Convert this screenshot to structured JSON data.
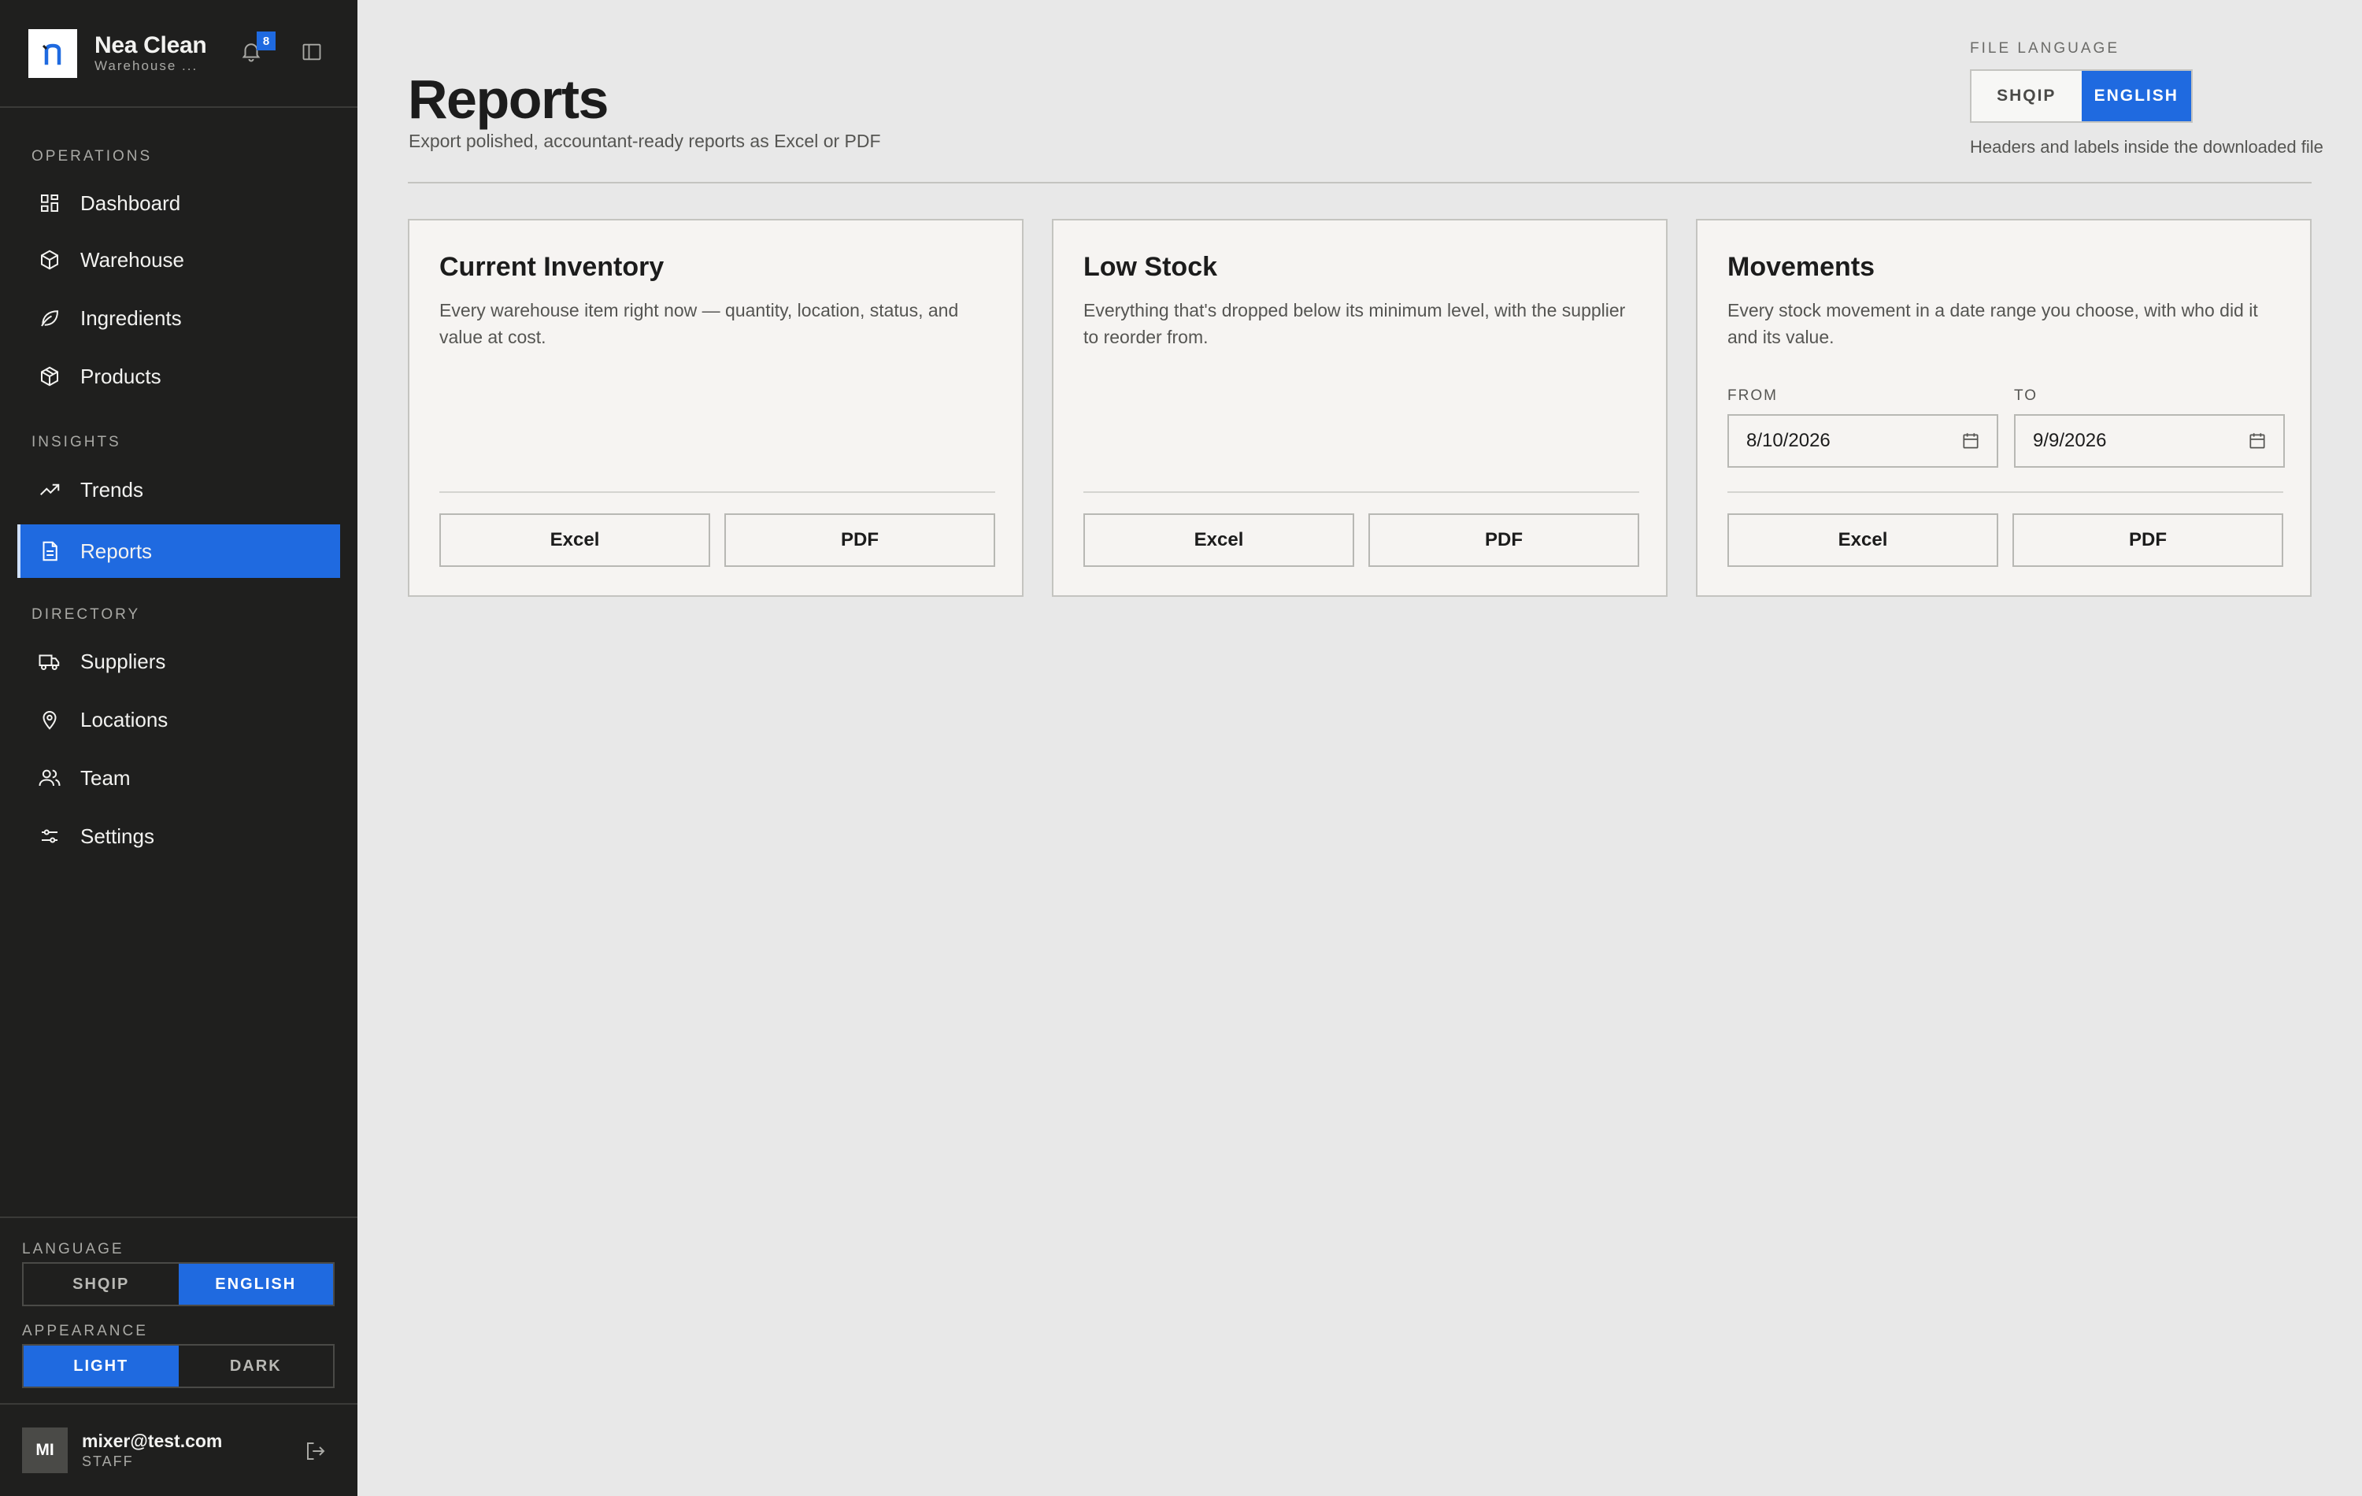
{
  "brand": {
    "name": "Nea Clean",
    "subtitle": "Warehouse ..."
  },
  "notifications": {
    "count": "8"
  },
  "nav": {
    "sections": {
      "operations": "OPERATIONS",
      "insights": "INSIGHTS",
      "directory": "DIRECTORY"
    },
    "items": [
      {
        "label": "Dashboard",
        "icon": "grid-icon"
      },
      {
        "label": "Warehouse",
        "icon": "box-icon"
      },
      {
        "label": "Ingredients",
        "icon": "leaf-icon"
      },
      {
        "label": "Products",
        "icon": "package-icon"
      },
      {
        "label": "Trends",
        "icon": "trend-icon"
      },
      {
        "label": "Reports",
        "icon": "report-icon",
        "active": true
      },
      {
        "label": "Suppliers",
        "icon": "truck-icon"
      },
      {
        "label": "Locations",
        "icon": "map-pin-icon"
      },
      {
        "label": "Team",
        "icon": "users-icon"
      },
      {
        "label": "Settings",
        "icon": "sliders-icon"
      }
    ]
  },
  "sidebar_settings": {
    "language_label": "LANGUAGE",
    "language_options": [
      "SHQIP",
      "ENGLISH"
    ],
    "language_selected": "ENGLISH",
    "appearance_label": "APPEARANCE",
    "appearance_options": [
      "LIGHT",
      "DARK"
    ],
    "appearance_selected": "LIGHT"
  },
  "user": {
    "initials": "MI",
    "email": "mixer@test.com",
    "role": "STAFF"
  },
  "page": {
    "title": "Reports",
    "subtitle": "Export polished, accountant-ready reports as Excel or PDF"
  },
  "file_language": {
    "label": "FILE LANGUAGE",
    "options": [
      "SHQIP",
      "ENGLISH"
    ],
    "selected": "ENGLISH",
    "hint": "Headers and labels inside the downloaded file"
  },
  "cards": [
    {
      "title": "Current Inventory",
      "description": "Every warehouse item right now — quantity, location, status, and value at cost.",
      "excel_label": "Excel",
      "pdf_label": "PDF"
    },
    {
      "title": "Low Stock",
      "description": "Everything that's dropped below its minimum level, with the supplier to reorder from.",
      "excel_label": "Excel",
      "pdf_label": "PDF"
    },
    {
      "title": "Movements",
      "description": "Every stock movement in a date range you choose, with who did it and its value.",
      "from_label": "FROM",
      "from_value": "8/10/2026",
      "to_label": "TO",
      "to_value": "9/9/2026",
      "excel_label": "Excel",
      "pdf_label": "PDF"
    }
  ],
  "colors": {
    "accent": "#1f6ae0",
    "sidebar_bg": "#1f1f1e",
    "page_bg": "#e8e8e8",
    "card_bg": "#f6f4f2"
  }
}
